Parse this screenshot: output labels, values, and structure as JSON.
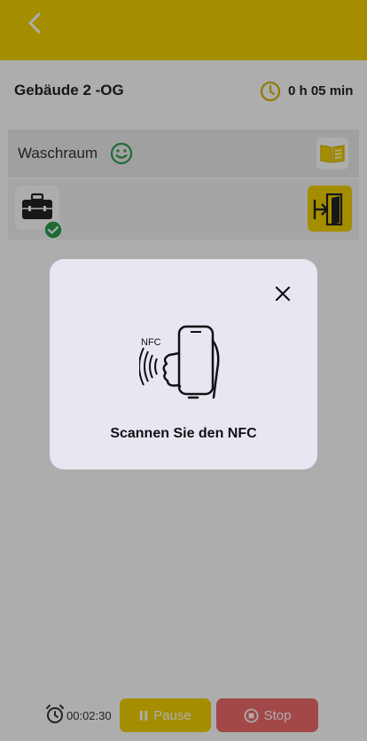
{
  "colors": {
    "accent": "#F2D200",
    "stop": "#F06A6A",
    "success": "#2E9E4F"
  },
  "header": {
    "back_icon": "chevron-left-icon"
  },
  "building": {
    "title": "Gebäude 2 -OG",
    "timer": "0 h 05 min"
  },
  "room": {
    "label": "Waschraum",
    "status_icon": "smiley-icon"
  },
  "actions": {
    "book_icon": "book-icon",
    "tool_icon": "toolbox-icon",
    "check_icon": "check-icon",
    "exit_icon": "exit-door-icon"
  },
  "footer": {
    "elapsed": "00:02:30",
    "pause_label": "Pause",
    "stop_label": "Stop"
  },
  "modal": {
    "nfc_label": "NFC",
    "message": "Scannen Sie den NFC"
  }
}
